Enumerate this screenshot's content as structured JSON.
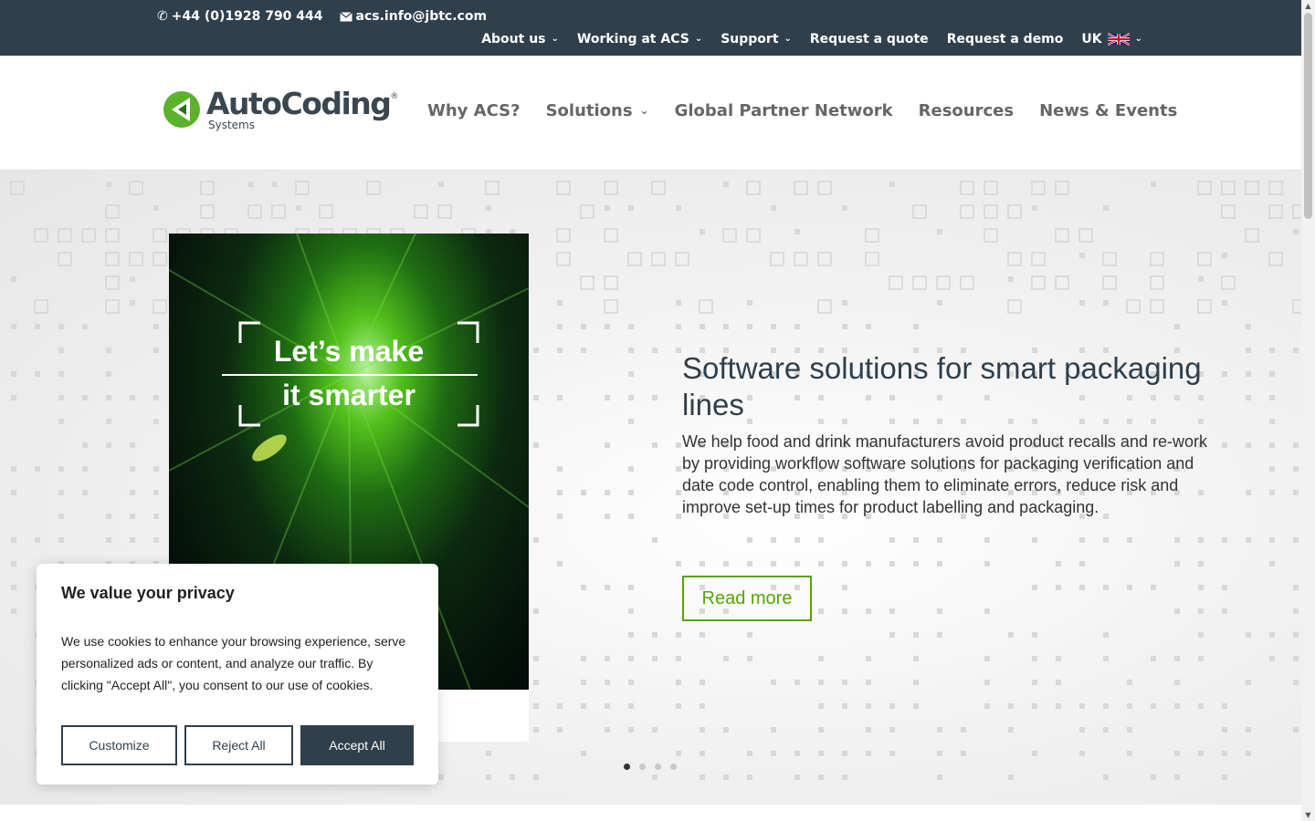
{
  "topbar": {
    "phone": "+44 (0)1928 790 444",
    "email": "acs.info@jbtc.com",
    "nav": [
      {
        "label": "About us",
        "has_dropdown": true
      },
      {
        "label": "Working at ACS",
        "has_dropdown": true
      },
      {
        "label": "Support",
        "has_dropdown": true
      },
      {
        "label": "Request a quote",
        "has_dropdown": false
      },
      {
        "label": "Request a demo",
        "has_dropdown": false
      }
    ],
    "region": "UK"
  },
  "logo": {
    "brand": "AutoCoding",
    "registered": "®",
    "sub": "Systems"
  },
  "mainnav": [
    {
      "label": "Why ACS?",
      "has_dropdown": false
    },
    {
      "label": "Solutions",
      "has_dropdown": true
    },
    {
      "label": "Global Partner Network",
      "has_dropdown": false
    },
    {
      "label": "Resources",
      "has_dropdown": false
    },
    {
      "label": "News & Events",
      "has_dropdown": false
    }
  ],
  "hero": {
    "poster_line1": "Let’s make",
    "poster_line2": "it smarter",
    "heading": "Software solutions for smart packaging lines",
    "body": "We help food and drink manufacturers avoid product recalls and re-work by providing workflow software solutions for packaging verification and date code control, enabling them to eliminate errors, reduce risk and improve set-up times for product labelling and packaging.",
    "cta": "Read more",
    "slides": 4,
    "active_slide": 1
  },
  "cookie": {
    "title": "We value your privacy",
    "text": "We use cookies to enhance your browsing experience, serve personalized ads or content, and analyze our traffic. By clicking \"Accept All\", you consent to our use of cookies.",
    "customize": "Customize",
    "reject": "Reject All",
    "accept": "Accept All"
  },
  "colors": {
    "topbar": "#2f3f4b",
    "accent_green": "#55a500",
    "nav_text": "#666666"
  }
}
